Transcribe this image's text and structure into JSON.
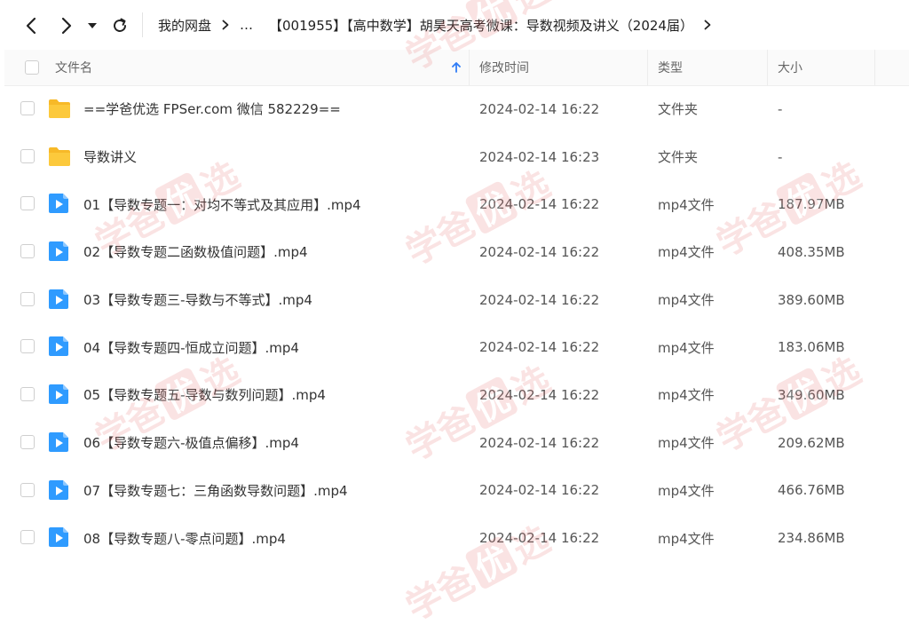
{
  "breadcrumb": {
    "root": "我的网盘",
    "ellipsis": "…",
    "current": "【001955】【高中数学】胡昊天高考微课：导数视频及讲义（2024届）"
  },
  "columns": {
    "name": "文件名",
    "modified": "修改时间",
    "type": "类型",
    "size": "大小"
  },
  "files": [
    {
      "name": "==学爸优选 FPSer.com 微信 582229==",
      "modified": "2024-02-14 16:22",
      "type": "文件夹",
      "size": "-",
      "icon": "folder-icon"
    },
    {
      "name": "导数讲义",
      "modified": "2024-02-14 16:23",
      "type": "文件夹",
      "size": "-",
      "icon": "folder-icon"
    },
    {
      "name": "01【导数专题一：对均不等式及其应用】.mp4",
      "modified": "2024-02-14 16:22",
      "type": "mp4文件",
      "size": "187.97MB",
      "icon": "video-file-icon"
    },
    {
      "name": "02【导数专题二函数极值问题】.mp4",
      "modified": "2024-02-14 16:22",
      "type": "mp4文件",
      "size": "408.35MB",
      "icon": "video-file-icon"
    },
    {
      "name": "03【导数专题三-导数与不等式】.mp4",
      "modified": "2024-02-14 16:22",
      "type": "mp4文件",
      "size": "389.60MB",
      "icon": "video-file-icon"
    },
    {
      "name": "04【导数专题四-恒成立问题】.mp4",
      "modified": "2024-02-14 16:22",
      "type": "mp4文件",
      "size": "183.06MB",
      "icon": "video-file-icon"
    },
    {
      "name": "05【导数专题五-导数与数列问题】.mp4",
      "modified": "2024-02-14 16:22",
      "type": "mp4文件",
      "size": "349.60MB",
      "icon": "video-file-icon"
    },
    {
      "name": "06【导数专题六-极值点偏移】.mp4",
      "modified": "2024-02-14 16:22",
      "type": "mp4文件",
      "size": "209.62MB",
      "icon": "video-file-icon"
    },
    {
      "name": "07【导数专题七：三角函数导数问题】.mp4",
      "modified": "2024-02-14 16:22",
      "type": "mp4文件",
      "size": "466.76MB",
      "icon": "video-file-icon"
    },
    {
      "name": "08【导数专题八-零点问题】.mp4",
      "modified": "2024-02-14 16:22",
      "type": "mp4文件",
      "size": "234.86MB",
      "icon": "video-file-icon"
    }
  ],
  "watermark": {
    "text_left": "学爸",
    "text_right": "选",
    "stamp_text": "优"
  },
  "colors": {
    "folder": "#f9c23c",
    "video": "#2f9bff",
    "sort_arrow": "#2f7cf6",
    "watermark": "#e66a6a"
  }
}
